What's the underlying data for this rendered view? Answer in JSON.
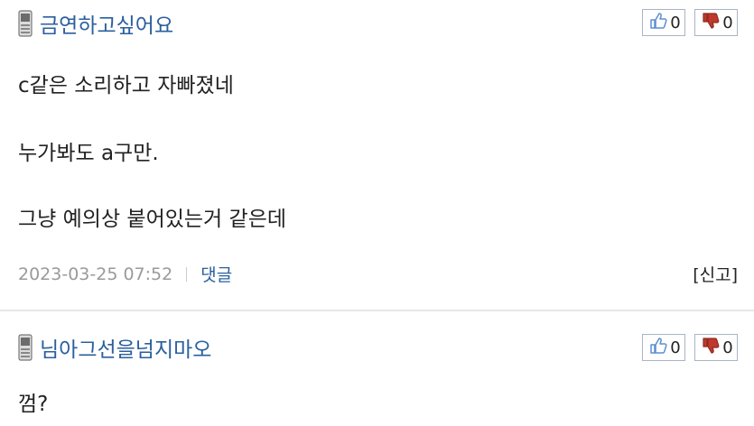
{
  "comments": [
    {
      "author": "금연하고싶어요",
      "likes": "0",
      "dislikes": "0",
      "lines": [
        "c같은 소리하고 자빠졌네",
        "누가봐도 a구만.",
        "그냥 예의상 붙어있는거 같은데"
      ],
      "date": "2023-03-25 07:52",
      "reply_label": "댓글",
      "report_label": "[신고]"
    },
    {
      "author": "님아그선을넘지마오",
      "likes": "0",
      "dislikes": "0",
      "lines": [
        "껌?"
      ]
    }
  ],
  "icons": {
    "device": "mobile-phone-icon",
    "like": "thumbs-up-icon",
    "dislike": "thumbs-down-icon"
  },
  "colors": {
    "author": "#2a5f9e",
    "date": "#9a9a9a",
    "thumb_up": "#5b8fd1",
    "thumb_down": "#c0392b"
  }
}
